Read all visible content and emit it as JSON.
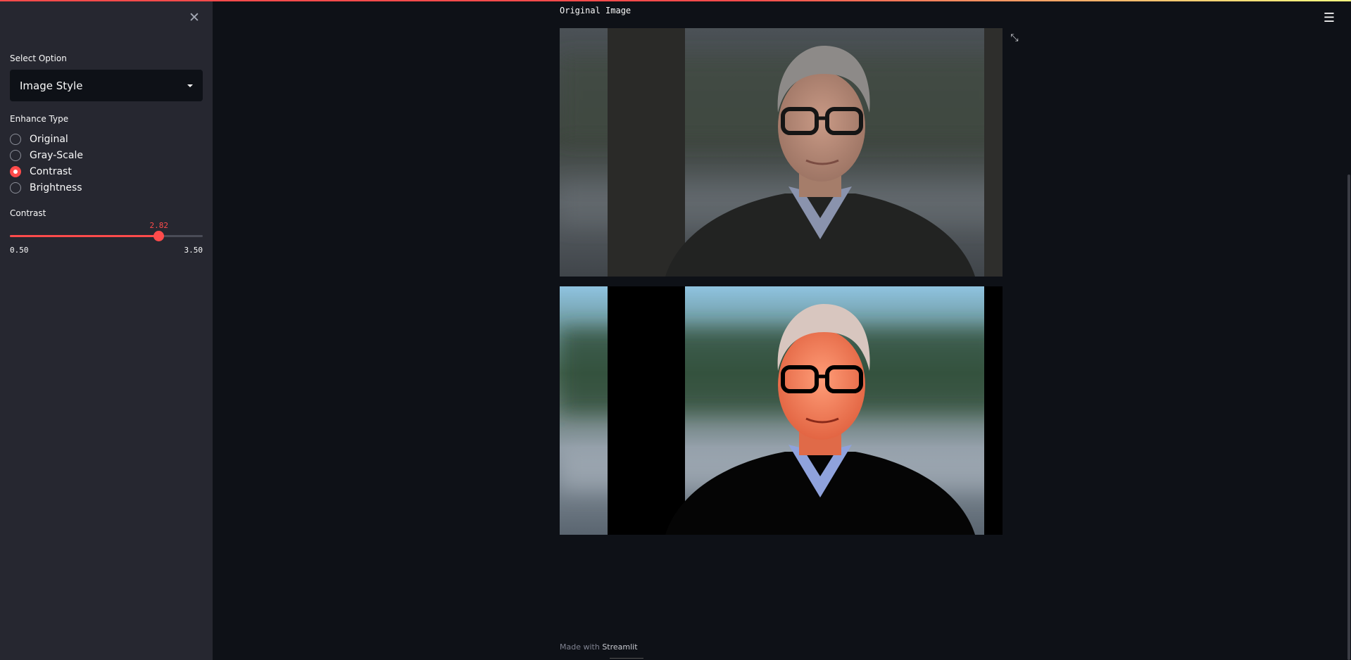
{
  "sidebar": {
    "close_icon": "close-icon",
    "select_label": "Select Option",
    "select_value": "Image Style",
    "enhance_label": "Enhance Type",
    "radio_options": [
      "Original",
      "Gray-Scale",
      "Contrast",
      "Brightness"
    ],
    "radio_selected": "Contrast",
    "slider_label": "Contrast",
    "slider_value": "2.82",
    "slider_min": "0.50",
    "slider_max": "3.50",
    "slider_fraction": 0.773
  },
  "main": {
    "title": "Original Image",
    "fullscreen_icon": "expand-icon",
    "menu_icon": "hamburger-menu-icon"
  },
  "footer": {
    "made_with": "Made with",
    "brand": "Streamlit"
  },
  "colors": {
    "accent": "#ff4b4b",
    "background": "#0e1117",
    "sidebar": "#262730"
  }
}
